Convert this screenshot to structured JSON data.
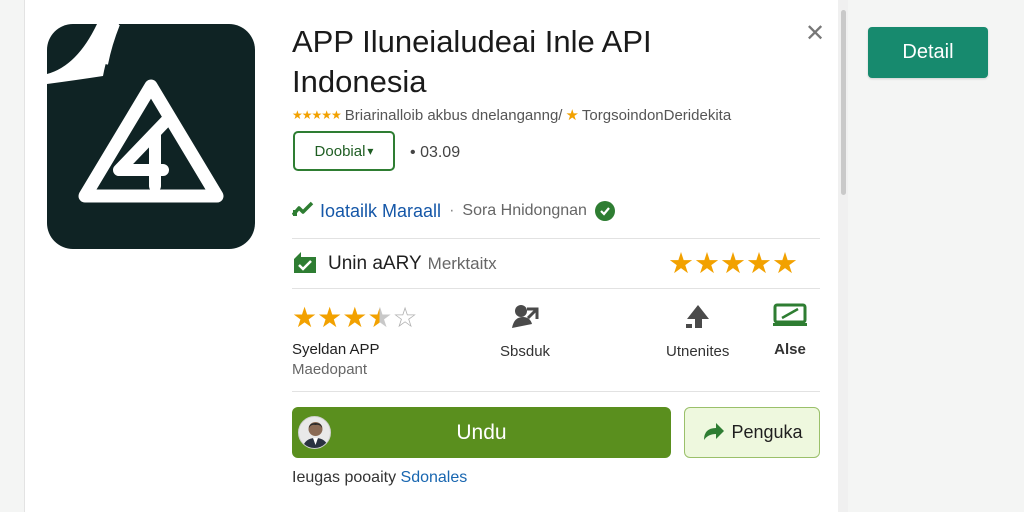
{
  "app": {
    "title_line1": "APP Iluneialudeai Inle API",
    "title_line2": "Indonesia",
    "meta_text": "Briarinalloib akbus dnelanganng/",
    "meta_tag": "TorgsoindonDeridekita",
    "download_select": "Doobial",
    "download_chevron": "▾",
    "size_prefix": "•",
    "size_text": "03.09"
  },
  "developer": {
    "name": "Ioatailk Maraall",
    "separator": "·",
    "subtitle": "Sora Hnidongnan"
  },
  "rating_row": {
    "title": "Unin aARY",
    "subtitle": "Merktaitx",
    "stars": 5
  },
  "stats": {
    "rating_value_stars": 3.5,
    "rating_label": "Syeldan APP",
    "rating_sub": "Maedopant",
    "col2_label": "Sbsduk",
    "col3_label": "Utnenites",
    "col4_label": "Alse"
  },
  "actions": {
    "install_label": "Undu",
    "share_label": "Penguka"
  },
  "footer": {
    "prefix": "Ieugas pooaity",
    "link": "Sdonales"
  },
  "side": {
    "detail_label": "Detail"
  },
  "close_symbol": "✕",
  "colors": {
    "brand_green": "#5a8f1e",
    "teal": "#178a6e",
    "star": "#f2a100",
    "icon_bg": "#0f2324",
    "link": "#1557a8"
  },
  "icons": [
    "close-icon",
    "check-badge-icon",
    "chart-up-icon",
    "share-icon",
    "upload-icon",
    "display-icon",
    "verified-icon",
    "avatar-icon"
  ]
}
